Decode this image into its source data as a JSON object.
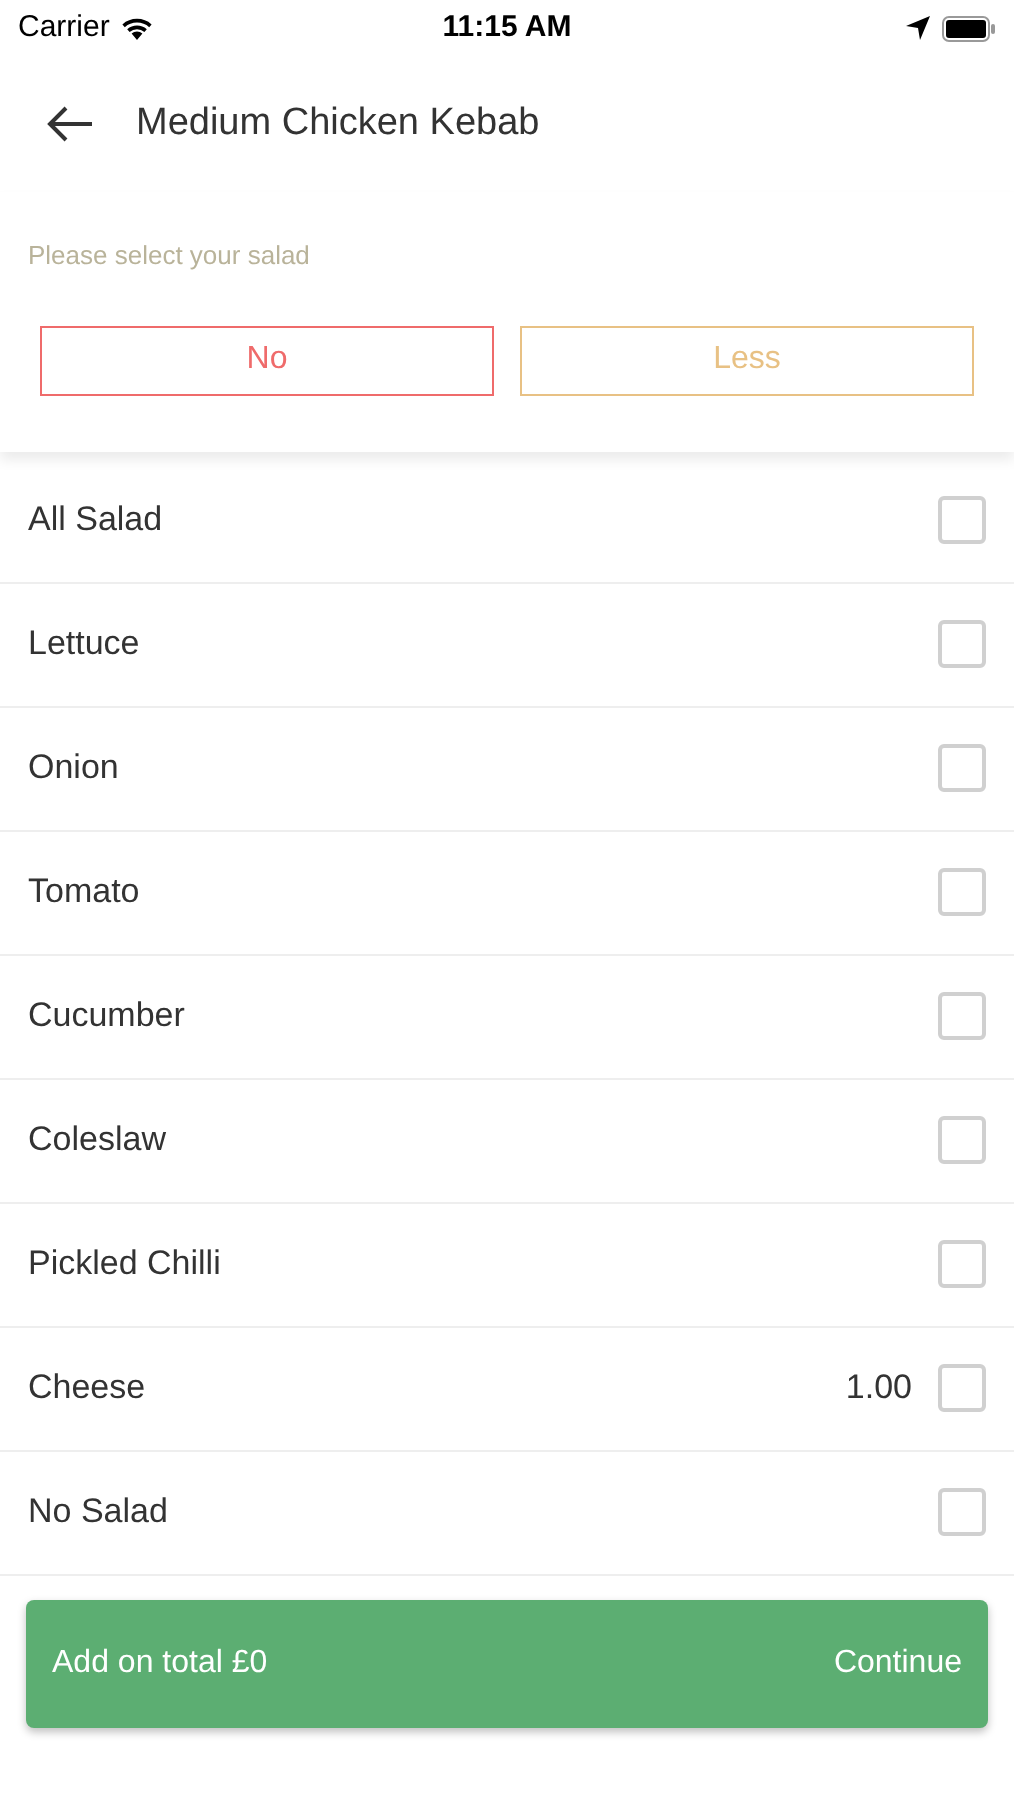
{
  "status_bar": {
    "carrier": "Carrier",
    "time": "11:15 AM"
  },
  "header": {
    "title": "Medium Chicken Kebab"
  },
  "prompt": "Please select your salad",
  "choices": [
    {
      "label": "No",
      "color": "#ef6b6b"
    },
    {
      "label": "Less",
      "color": "#e8c184"
    }
  ],
  "items": [
    {
      "name": "All Salad",
      "checked": false
    },
    {
      "name": "Lettuce",
      "checked": false
    },
    {
      "name": "Onion",
      "checked": false
    },
    {
      "name": "Tomato",
      "checked": false
    },
    {
      "name": "Cucumber",
      "checked": false
    },
    {
      "name": "Coleslaw",
      "checked": false
    },
    {
      "name": "Pickled Chilli",
      "checked": false
    },
    {
      "name": "Cheese",
      "price": "1.00",
      "checked": false
    },
    {
      "name": "No Salad",
      "checked": false
    }
  ],
  "footer": {
    "total": "Add on total £0",
    "action": "Continue"
  }
}
